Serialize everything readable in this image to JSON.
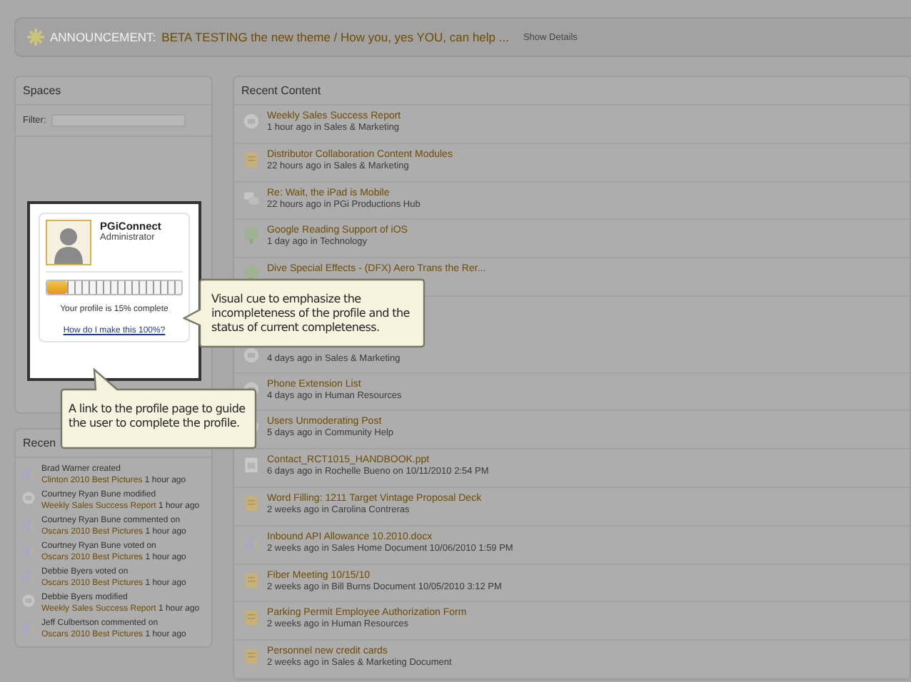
{
  "announcement": {
    "label": "ANNOUNCEMENT:",
    "link": "BETA TESTING the new theme / How you, yes YOU, can help ...",
    "details": "Show Details"
  },
  "spaces": {
    "title": "Spaces",
    "filter_label": "Filter:"
  },
  "profile": {
    "name": "PGiConnect",
    "role": "Administrator",
    "completion": {
      "level": 0.15
    },
    "status": "Your profile is 15% complete",
    "link": "How do I make this 100%?"
  },
  "activity": {
    "title": "Recen",
    "items": [
      {
        "kind": "poll",
        "user": "Brad Warner",
        "action": "created",
        "target": "Clinton 2010 Best Pictures",
        "time": "1 hour ago"
      },
      {
        "kind": "discussion",
        "user": "Courtney Ryan Bune",
        "action": "modified",
        "target": "Weekly Sales Success Report",
        "time": "1 hour ago"
      },
      {
        "kind": "poll",
        "user": "Courtney Ryan Bune",
        "action": "commented on",
        "target": "Oscars 2010 Best Pictures",
        "time": "1 hour ago"
      },
      {
        "kind": "poll",
        "user": "Courtney Ryan Bune",
        "action": "voted on",
        "target": "Oscars 2010 Best Pictures",
        "time": "1 hour ago"
      },
      {
        "kind": "poll",
        "user": "Debbie Byers",
        "action": "voted on",
        "target": "Oscars 2010 Best Pictures",
        "time": "1 hour ago"
      },
      {
        "kind": "discussion",
        "user": "Debbie Byers",
        "action": "modified",
        "target": "Weekly Sales Success Report",
        "time": "1 hour ago"
      },
      {
        "kind": "poll",
        "user": "Jeff Culbertson",
        "action": "commented on",
        "target": "Oscars 2010 Best Pictures",
        "time": "1 hour ago"
      }
    ]
  },
  "recent_content": {
    "title": "Recent Content",
    "items": [
      {
        "kind": "discussion",
        "title": "Weekly Sales Success Report",
        "meta": "1 hour ago in Sales & Marketing"
      },
      {
        "kind": "document",
        "title": "Distributor Collaboration Content Modules",
        "meta": "22 hours ago in Sales & Marketing"
      },
      {
        "kind": "thread",
        "title": "Re: Wait, the iPad is Mobile",
        "meta": "22 hours ago in PGi Productions Hub"
      },
      {
        "kind": "blog",
        "title": "Google Reading Support of iOS",
        "meta": "1 day ago in Technology"
      },
      {
        "kind": "blog",
        "title": "Dive Special Effects - (DFX) Aero Trans the Rer..."
      },
      {
        "kind": "discussion",
        "meta": "4 days ago in Sales & Marketing"
      },
      {
        "kind": "discussion",
        "title": "Phone Extension List",
        "meta": "4 days ago in Human Resources"
      },
      {
        "kind": "discussion",
        "title": "Users Unmoderating Post",
        "meta": "5 days ago in Community Help"
      },
      {
        "kind": "file",
        "title": "Contact_RCT1015_HANDBOOK.ppt",
        "meta": "6 days ago in Rochelle Bueno on 10/11/2010 2:54 PM"
      },
      {
        "kind": "document",
        "title": "Word Filling: 1211 Target Vintage Proposal Deck",
        "meta": "2 weeks ago in Carolina Contreras"
      },
      {
        "kind": "poll",
        "title": "Inbound API Allowance 10.2010.docx",
        "meta": "2 weeks ago in Sales Home Document 10/06/2010 1:59 PM"
      },
      {
        "kind": "document",
        "title": "Fiber Meeting 10/15/10",
        "meta": "2 weeks ago in Bill Burns Document 10/05/2010 3:12 PM"
      },
      {
        "kind": "document",
        "title": "Parking Permit Employee Authorization Form",
        "meta": "2 weeks ago in Human Resources"
      },
      {
        "kind": "document",
        "title": "Personnel new credit cards",
        "meta": "2 weeks ago in Sales & Marketing Document"
      }
    ]
  },
  "callouts": [
    {
      "kind": "left",
      "text": "Visual cue to emphasize the incompleteness of the profile and the status of current completeness."
    },
    {
      "kind": "up",
      "text": "A link to the profile page to guide the user to complete the profile."
    }
  ]
}
